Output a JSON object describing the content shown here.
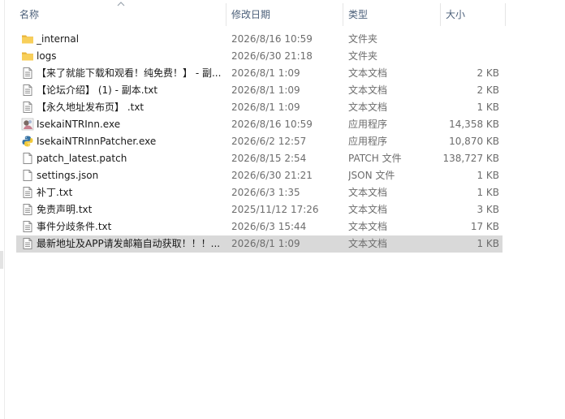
{
  "columns": {
    "name": "名称",
    "date": "修改日期",
    "type": "类型",
    "size": "大小"
  },
  "sort": {
    "column": "name",
    "direction": "ascending",
    "icon": "chevron-up-icon"
  },
  "colors": {
    "header_text": "#4c607a",
    "selected_row_bg": "#d9d9d9",
    "folder_yellow": "#f6c544"
  },
  "files": [
    {
      "name": "_internal",
      "date": "2026/8/16 10:59",
      "type": "文件夹",
      "size": "",
      "icon": "folder-icon"
    },
    {
      "name": "logs",
      "date": "2026/6/30 21:18",
      "type": "文件夹",
      "size": "",
      "icon": "folder-icon"
    },
    {
      "name": "【来了就能下载和观看！纯免费！】 - 副...",
      "date": "2026/8/1 1:09",
      "type": "文本文档",
      "size": "2 KB",
      "icon": "text-file-icon"
    },
    {
      "name": "【论坛介绍】 (1) - 副本.txt",
      "date": "2026/8/1 1:09",
      "type": "文本文档",
      "size": "2 KB",
      "icon": "text-file-icon"
    },
    {
      "name": "【永久地址发布页】 .txt",
      "date": "2026/8/1 1:09",
      "type": "文本文档",
      "size": "1 KB",
      "icon": "text-file-icon"
    },
    {
      "name": "IsekaiNTRInn.exe",
      "date": "2026/8/16 10:59",
      "type": "应用程序",
      "size": "14,358 KB",
      "icon": "app-exe-icon"
    },
    {
      "name": "IsekaiNTRInnPatcher.exe",
      "date": "2026/6/2 12:57",
      "type": "应用程序",
      "size": "10,870 KB",
      "icon": "python-exe-icon"
    },
    {
      "name": "patch_latest.patch",
      "date": "2026/8/15 2:54",
      "type": "PATCH 文件",
      "size": "138,727 KB",
      "icon": "blank-file-icon"
    },
    {
      "name": "settings.json",
      "date": "2026/6/30 21:21",
      "type": "JSON 文件",
      "size": "1 KB",
      "icon": "blank-file-icon"
    },
    {
      "name": "补丁.txt",
      "date": "2026/6/3 1:35",
      "type": "文本文档",
      "size": "1 KB",
      "icon": "text-file-icon"
    },
    {
      "name": "免责声明.txt",
      "date": "2025/11/12 17:26",
      "type": "文本文档",
      "size": "3 KB",
      "icon": "text-file-icon"
    },
    {
      "name": "事件分歧条件.txt",
      "date": "2026/6/3 15:44",
      "type": "文本文档",
      "size": "17 KB",
      "icon": "text-file-icon"
    },
    {
      "name": "最新地址及APP请发邮箱自动获取！！！...",
      "date": "2026/8/1 1:09",
      "type": "文本文档",
      "size": "1 KB",
      "icon": "text-file-icon",
      "selected": true
    }
  ]
}
